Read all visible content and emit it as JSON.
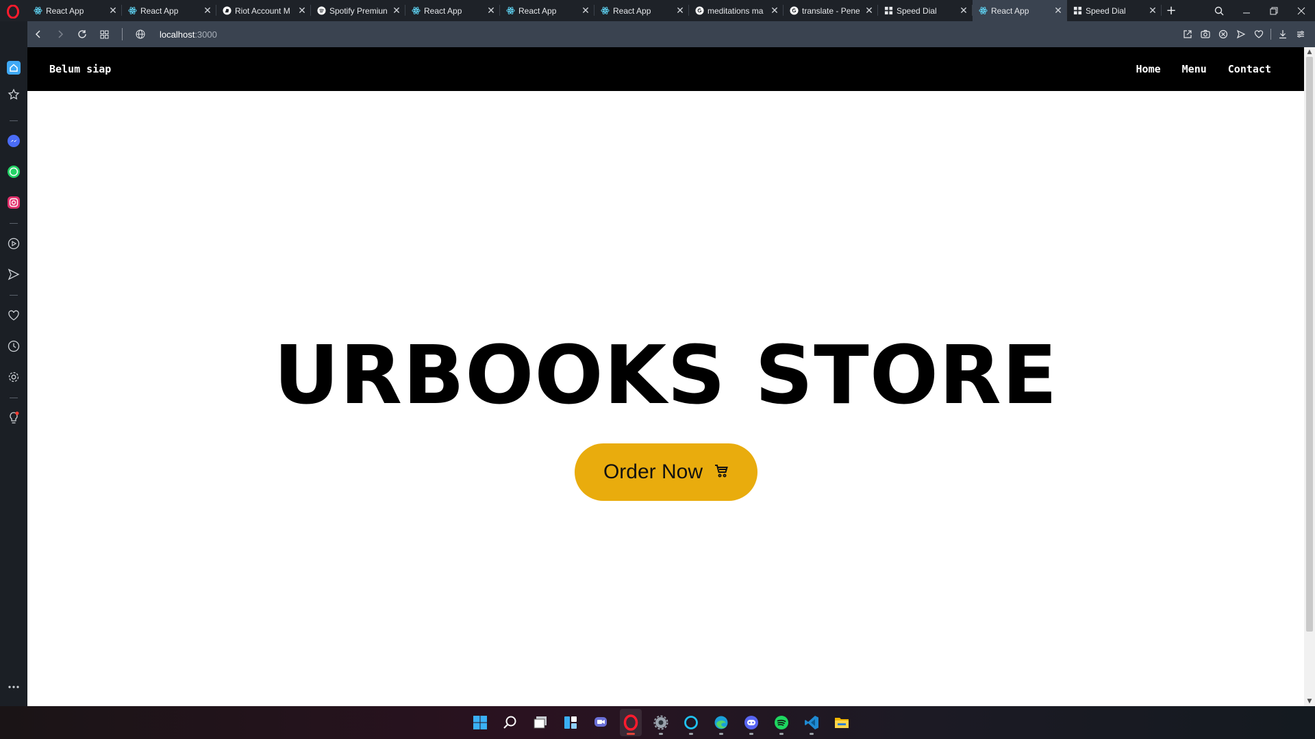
{
  "browser": {
    "tabs": [
      {
        "title": "React App",
        "favicon": "react-icon",
        "active": false
      },
      {
        "title": "React App",
        "favicon": "react-icon",
        "active": false
      },
      {
        "title": "Riot Account M",
        "favicon": "riot-icon",
        "active": false
      },
      {
        "title": "Spotify Premiun",
        "favicon": "spotify-icon",
        "active": false
      },
      {
        "title": "React App",
        "favicon": "react-icon",
        "active": false
      },
      {
        "title": "React App",
        "favicon": "react-icon",
        "active": false
      },
      {
        "title": "React App",
        "favicon": "react-icon",
        "active": false
      },
      {
        "title": "meditations ma",
        "favicon": "google-icon",
        "active": false
      },
      {
        "title": "translate - Pene",
        "favicon": "google-icon",
        "active": false
      },
      {
        "title": "Speed Dial",
        "favicon": "speed-dial-icon",
        "active": false
      },
      {
        "title": "React App",
        "favicon": "react-icon",
        "active": true
      },
      {
        "title": "Speed Dial",
        "favicon": "speed-dial-icon",
        "active": false
      }
    ],
    "url": {
      "host": "localhost",
      "port": ":3000"
    },
    "new_tab_label": "+"
  },
  "page": {
    "brand": "Belum siap",
    "nav": [
      "Home",
      "Menu",
      "Contact"
    ],
    "hero_title": "URBOOKS STORE",
    "cta_label": "Order Now",
    "cta_color": "#e9ac0d"
  },
  "sidebar": [
    "home-icon",
    "star-icon",
    "messenger-icon",
    "whatsapp-icon",
    "instagram-icon",
    "player-icon",
    "send-icon",
    "heart-icon",
    "history-icon",
    "settings-icon",
    "tips-icon",
    "more-icon"
  ],
  "taskbar": [
    "windows-start-icon",
    "search-icon",
    "task-view-icon",
    "widgets-icon",
    "chat-icon",
    "opera-icon",
    "settings-icon",
    "alexa-icon",
    "edge-icon",
    "discord-icon",
    "spotify-icon",
    "vscode-icon",
    "file-explorer-icon"
  ]
}
